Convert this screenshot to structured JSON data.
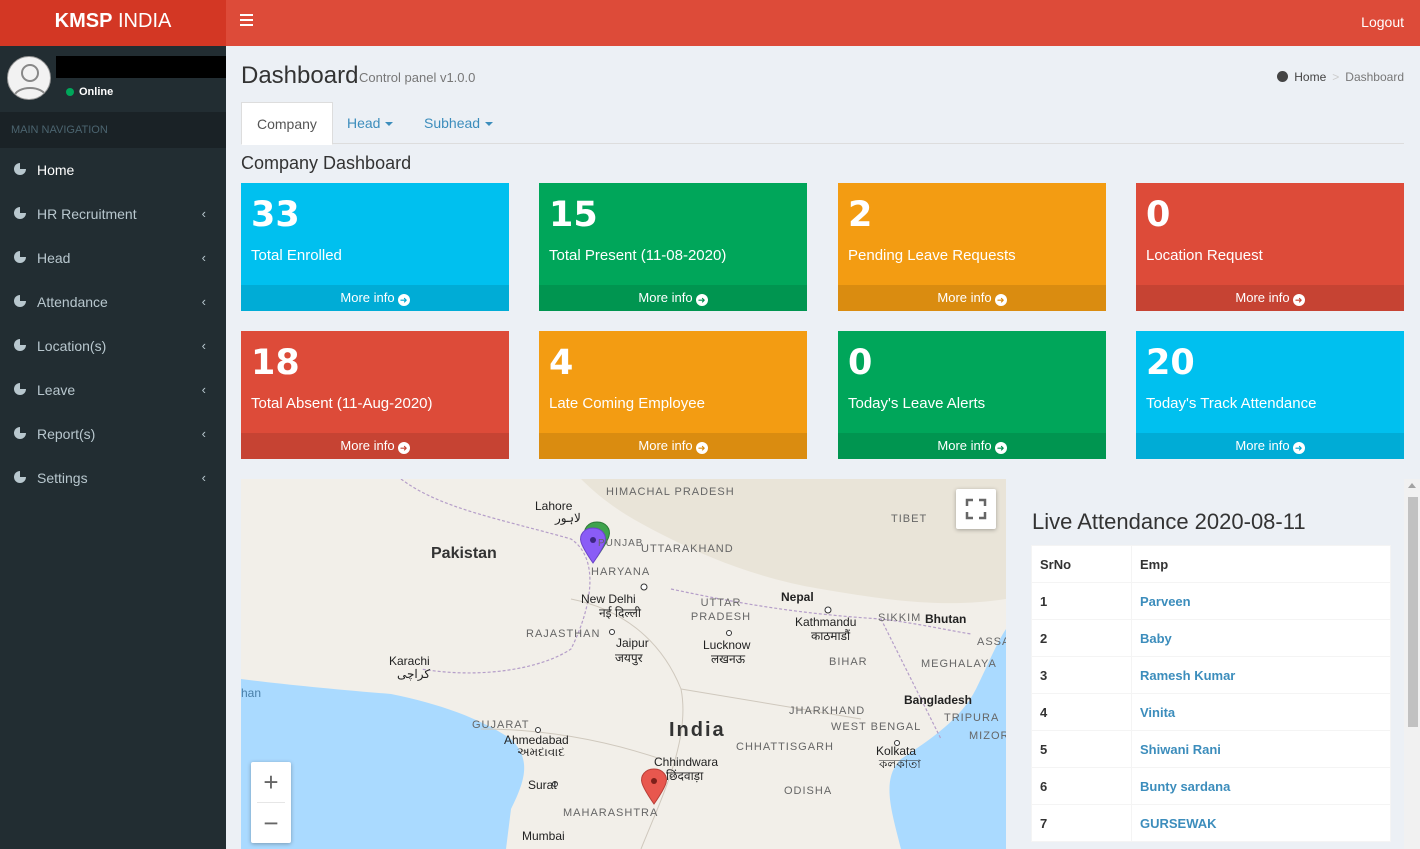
{
  "header": {
    "logo_bold": "KMSP",
    "logo_rest": " INDIA",
    "logout_label": "Logout"
  },
  "sidebar": {
    "status": "Online",
    "nav_header": "MAIN NAVIGATION",
    "items": [
      {
        "label": "Home"
      },
      {
        "label": "HR Recruitment"
      },
      {
        "label": "Head"
      },
      {
        "label": "Attendance"
      },
      {
        "label": "Location(s)"
      },
      {
        "label": "Leave"
      },
      {
        "label": "Report(s)"
      },
      {
        "label": "Settings"
      }
    ]
  },
  "page": {
    "title": "Dashboard",
    "subtitle": "Control panel v1.0.0",
    "breadcrumb": {
      "home": "Home",
      "current": "Dashboard"
    }
  },
  "tabs": [
    {
      "label": "Company"
    },
    {
      "label": "Head"
    },
    {
      "label": "Subhead"
    }
  ],
  "section_title": "Company Dashboard",
  "boxes": [
    {
      "value": "33",
      "label": "Total Enrolled",
      "more": "More info",
      "color": "#00c0ef"
    },
    {
      "value": "15",
      "label": "Total Present (11-08-2020)",
      "more": "More info",
      "color": "#00a65a"
    },
    {
      "value": "2",
      "label": "Pending Leave Requests",
      "more": "More info",
      "color": "#f39c12"
    },
    {
      "value": "0",
      "label": "Location Request",
      "more": "More info",
      "color": "#dd4b39"
    },
    {
      "value": "18",
      "label": "Total Absent (11-Aug-2020)",
      "more": "More info",
      "color": "#dd4b39"
    },
    {
      "value": "4",
      "label": "Late Coming Employee",
      "more": "More info",
      "color": "#f39c12"
    },
    {
      "value": "0",
      "label": "Today's Leave Alerts",
      "more": "More info",
      "color": "#00a65a"
    },
    {
      "value": "20",
      "label": "Today's Track Attendance",
      "more": "More info",
      "color": "#00c0ef"
    }
  ],
  "map": {
    "labels": {
      "himachal": "HIMACHAL PRADESH",
      "lahore": "Lahore",
      "lahore_ur": "لاہور",
      "pakistan": "Pakistan",
      "tibet": "TIBET",
      "punjab": "PUNJAB",
      "uttarakhand": "UTTARAKHAND",
      "haryana": "HARYANA",
      "newdelhi": "New Delhi",
      "newdelhi_hi": "नई दिल्ली",
      "nepal": "Nepal",
      "uttarpradesh": "UTTAR PRADESH",
      "kathmandu": "Kathmandu",
      "kathmandu_ne": "काठमाडौं",
      "sikkim": "SIKKIM",
      "bhutan": "Bhutan",
      "rajasthan": "RAJASTHAN",
      "jaipur": "Jaipur",
      "jaipur_hi": "जयपुर",
      "lucknow": "Lucknow",
      "lucknow_hi": "लखनऊ",
      "assam": "ASSA",
      "karachi": "Karachi",
      "karachi_ur": "کراچی",
      "bihar": "BIHAR",
      "meghalaya": "MEGHALAYA",
      "bangladesh": "Bangladesh",
      "han": "han",
      "jharkhand": "JHARKHAND",
      "tripura": "TRIPURA",
      "gujarat": "GUJARAT",
      "ahmedabad": "Ahmedabad",
      "ahmedabad_gu": "અમદાવાદ",
      "india": "India",
      "westbengal": "WEST BENGAL",
      "mizoram": "MIZOR",
      "chhattisgarh": "CHHATTISGARH",
      "chhindwara": "Chhindwara",
      "chhindwara_hi": "छिंदवाड़ा",
      "kolkata": "Kolkata",
      "kolkata_bn": "কলকাতা",
      "surat": "Surat",
      "odisha": "ODISHA",
      "maharashtra": "MAHARASHTRA",
      "mumbai": "Mumbai"
    },
    "zoom_in": "+",
    "zoom_out": "−",
    "marker_colors": [
      "#3fa34d",
      "#8a5cf6",
      "#e8574e"
    ]
  },
  "attendance": {
    "title": "Live Attendance 2020-08-11",
    "columns": [
      "SrNo",
      "Emp"
    ],
    "rows": [
      {
        "sr": "1",
        "emp": "Parveen"
      },
      {
        "sr": "2",
        "emp": "Baby"
      },
      {
        "sr": "3",
        "emp": "Ramesh Kumar"
      },
      {
        "sr": "4",
        "emp": "Vinita"
      },
      {
        "sr": "5",
        "emp": "Shiwani Rani"
      },
      {
        "sr": "6",
        "emp": "Bunty sardana"
      },
      {
        "sr": "7",
        "emp": "GURSEWAK"
      }
    ]
  }
}
